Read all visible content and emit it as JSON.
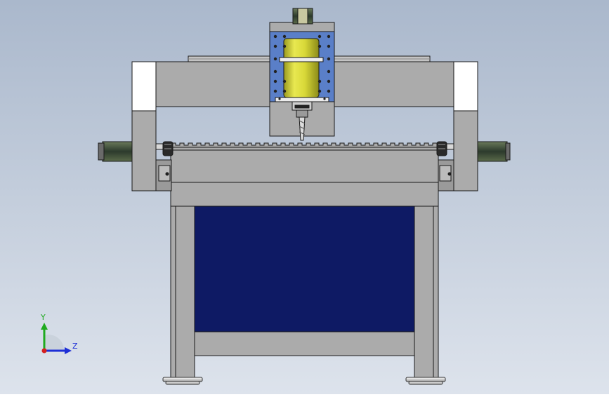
{
  "triad": {
    "y_label": "Y",
    "z_label": "Z",
    "y_color": "#1faa1f",
    "z_color": "#1d2fd6",
    "origin_color": "#d42020"
  },
  "colors": {
    "background_top": "#aab8cc",
    "background_bottom": "#dde3ec",
    "frame": "#ababab",
    "frame_edge": "#1a1a1a",
    "panel_blue": "#0e1a64",
    "spindle_plate": "#5a7fc8",
    "spindle_body": "#d8d838",
    "motor_dark": "#3a4a3a",
    "white_block": "#ffffff"
  }
}
